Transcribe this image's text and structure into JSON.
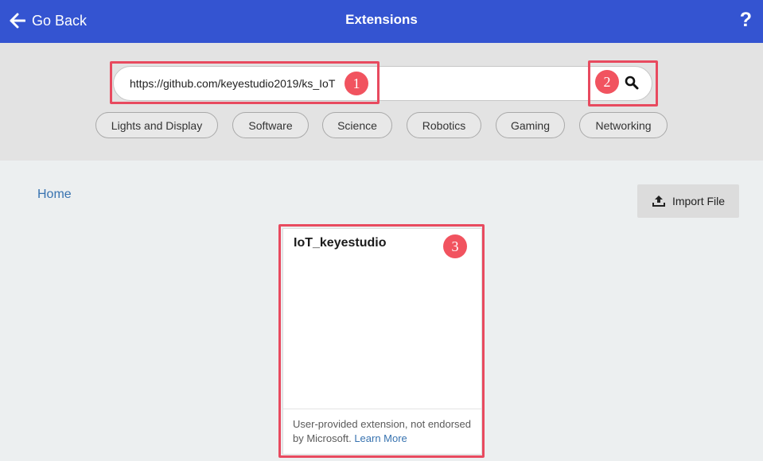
{
  "header": {
    "back_label": "Go Back",
    "title": "Extensions",
    "help_label": "?"
  },
  "search": {
    "value": "https://github.com/keyestudio2019/ks_IoT",
    "icon": "search-icon"
  },
  "tags": [
    "Lights and Display",
    "Software",
    "Science",
    "Robotics",
    "Gaming",
    "Networking"
  ],
  "breadcrumb": {
    "home": "Home"
  },
  "import": {
    "label": "Import File",
    "icon": "upload-icon"
  },
  "card": {
    "title": "IoT_keyestudio",
    "footer_text": "User-provided extension, not endorsed by Microsoft.",
    "learn_more": "Learn More"
  },
  "annotations": {
    "badge1": "1",
    "badge2": "2",
    "badge3": "3",
    "color": "#e84a5f"
  },
  "colors": {
    "header_bg": "#3454d1",
    "link": "#3873b0"
  }
}
